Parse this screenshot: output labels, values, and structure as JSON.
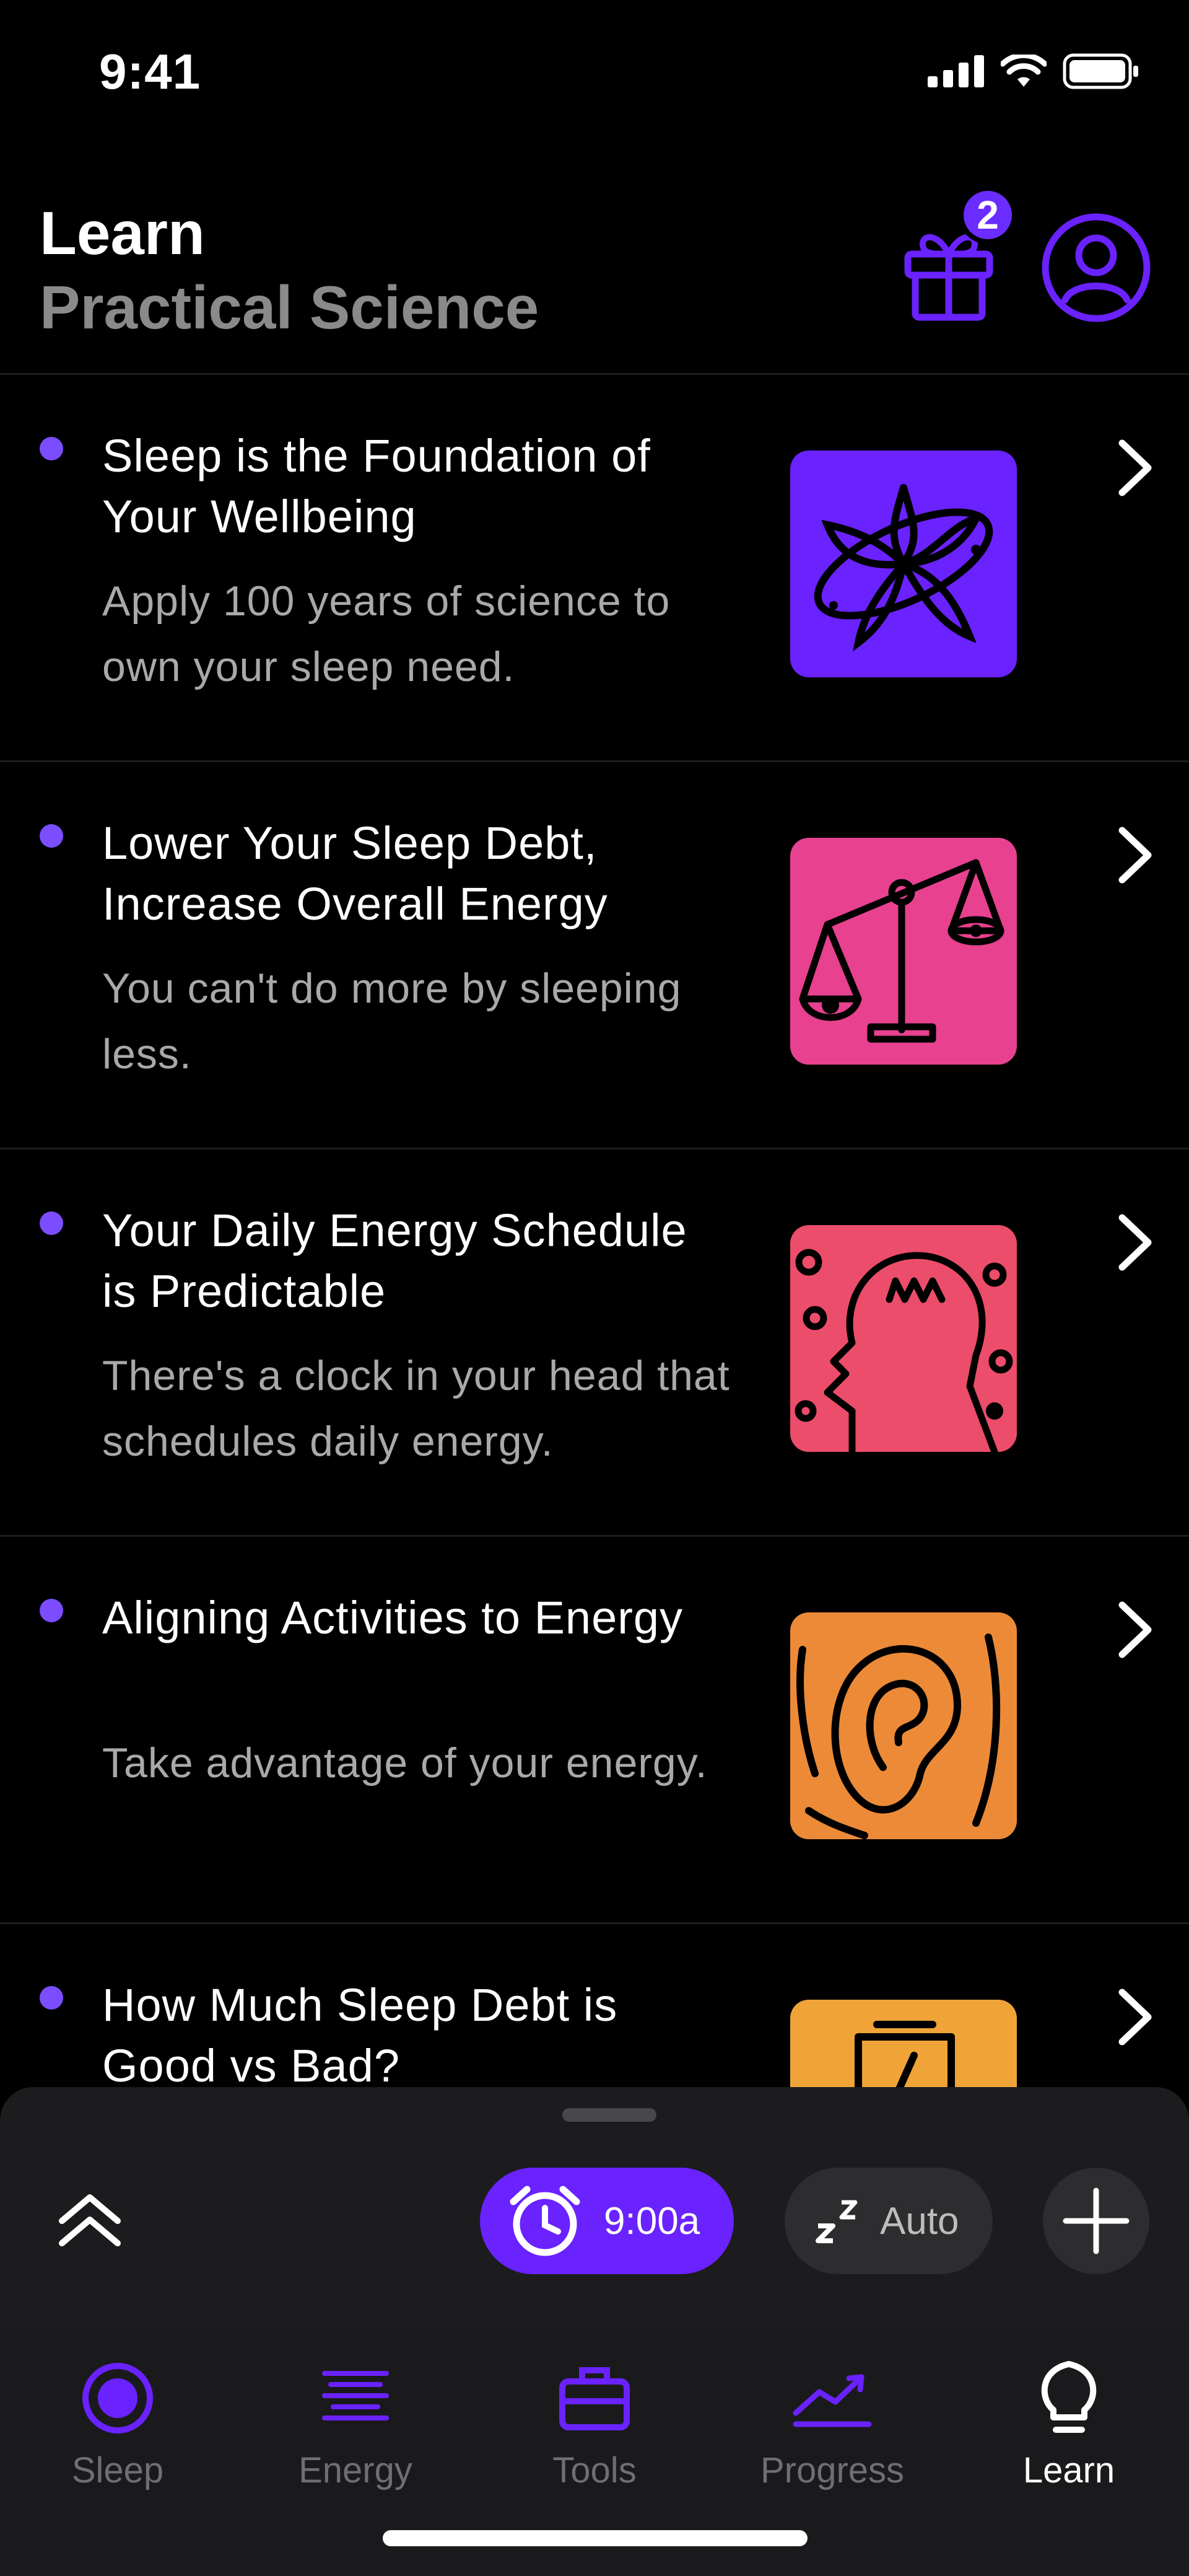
{
  "status_bar": {
    "time": "9:41"
  },
  "header": {
    "title": "Learn",
    "subtitle": "Practical Science",
    "gift_badge_count": "2",
    "icons": {
      "gift": "gift-icon",
      "profile": "profile-icon"
    }
  },
  "colors": {
    "accent": "#6a22ff",
    "dot": "#7b4dff",
    "thumb_1": "#6a22ff",
    "thumb_2": "#e8418f",
    "thumb_3": "#ec4d6a",
    "thumb_4": "#ec8a38",
    "thumb_5": "#f0a337"
  },
  "articles": [
    {
      "title": "Sleep is the Foundation of Your Wellbeing",
      "description": "Apply 100 years of science to own your sleep need.",
      "icon": "starburst-illustration"
    },
    {
      "title": "Lower Your Sleep Debt, Increase Overall Energy",
      "description": "You can't do more by sleeping less.",
      "icon": "scale-illustration"
    },
    {
      "title": "Your Daily Energy Schedule is Predictable",
      "description": "There's a clock in your head that schedules daily energy.",
      "icon": "head-profile-illustration"
    },
    {
      "title": "Aligning Activities to Energy",
      "description": "Take advantage of your energy.",
      "icon": "ear-illustration"
    },
    {
      "title": "How Much Sleep Debt is Good vs Bad?",
      "description": "",
      "icon": "battery-illustration"
    }
  ],
  "quick_actions": {
    "alarm_label": "9:00a",
    "auto_label": "Auto",
    "icons": {
      "expand": "double-chevron-up-icon",
      "alarm": "alarm-clock-icon",
      "sleep": "zz-icon",
      "add": "plus-icon"
    }
  },
  "tabs": [
    {
      "label": "Sleep",
      "icon": "sleep-target-icon",
      "active": false
    },
    {
      "label": "Energy",
      "icon": "energy-lines-icon",
      "active": false
    },
    {
      "label": "Tools",
      "icon": "toolbox-icon",
      "active": false
    },
    {
      "label": "Progress",
      "icon": "trend-line-icon",
      "active": false
    },
    {
      "label": "Learn",
      "icon": "lightbulb-icon",
      "active": true
    }
  ]
}
